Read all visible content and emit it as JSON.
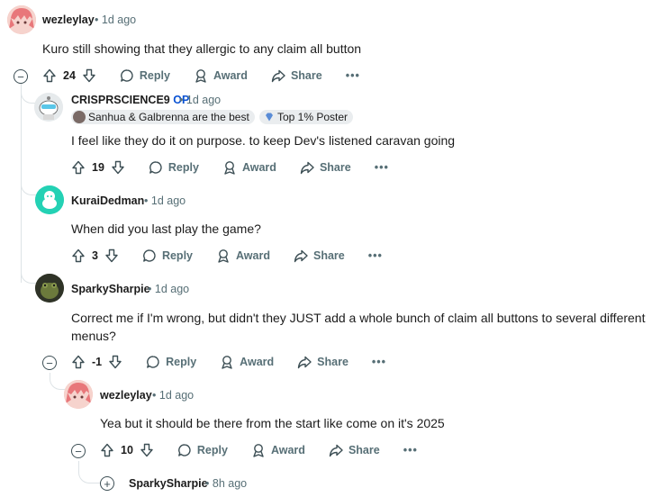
{
  "comments": [
    {
      "username": "wezleylay",
      "time": "1d ago",
      "body": "Kuro still showing that they allergic to any claim all button",
      "score": "24"
    },
    {
      "username": "CRISPRSCIENCE9",
      "op_badge": "OP",
      "time": "1d ago",
      "flairs": [
        "Sanhua & Galbrenna are the best",
        "Top 1% Poster"
      ],
      "body": "I feel like they do it on purpose. to keep Dev's listened caravan going",
      "score": "19"
    },
    {
      "username": "KuraiDedman",
      "time": "1d ago",
      "body": "When did you last play the game?",
      "score": "3"
    },
    {
      "username": "SparkySharpie",
      "time": "1d ago",
      "body_lines": [
        "Correct me if I'm wrong, but didn't they JUST add a whole bunch of claim all buttons to several different",
        "menus?"
      ],
      "score": "-1"
    },
    {
      "username": "wezleylay",
      "time": "1d ago",
      "body": "Yea but it should be there from the start like come on it's 2025",
      "score": "10"
    },
    {
      "username": "SparkySharpie",
      "time": "8h ago"
    }
  ],
  "actions": {
    "reply": "Reply",
    "award": "Award",
    "share": "Share",
    "more": "•••"
  },
  "separator": "•",
  "toggle_collapse": "−",
  "toggle_expand": "+",
  "colors": {
    "meta": "#576f76",
    "op": "#0a52d3",
    "thread": "#dde3e6",
    "flair_bg": "#eaedef"
  }
}
